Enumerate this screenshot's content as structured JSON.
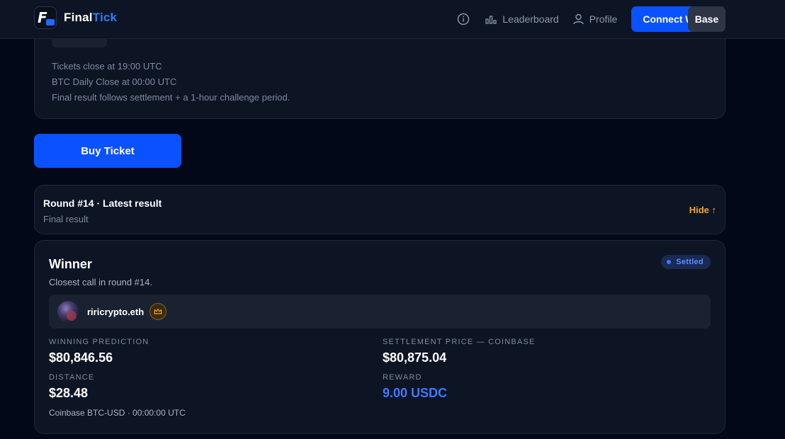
{
  "nav": {
    "brand_part1": "Final",
    "brand_part2": "Tick",
    "leaderboard_label": "Leaderboard",
    "profile_label": "Profile",
    "connect_label": "Connect Wallet",
    "network_label": "Base",
    "icons": [
      "info-icon",
      "leaderboard-icon",
      "profile-icon"
    ]
  },
  "info_card": {
    "lines": [
      "Tickets close at 19:00 UTC",
      "BTC Daily Close at 00:00 UTC",
      "Final result follows settlement + a 1-hour challenge period."
    ]
  },
  "buy_button_label": "Buy Ticket",
  "round": {
    "title": "Round #14 · Latest result",
    "subtitle": "Final result",
    "toggle_label": "Hide ↑"
  },
  "winner": {
    "title": "Winner",
    "subtitle": "Closest call in round #14.",
    "status": "Settled",
    "name": "riricrypto.eth",
    "winning_prediction_label": "Winning prediction",
    "winning_prediction": "$80,846.56",
    "settlement_label": "Settlement price — Coinbase",
    "settlement_price": "$80,875.04",
    "distance_label": "Distance",
    "distance": "$28.48",
    "reward_label": "Reward",
    "reward": "9.00 USDC",
    "source_note": "Coinbase BTC-USD · 00:00:00 UTC"
  },
  "colors": {
    "background": "#030818",
    "card": "#0d1424",
    "primary": "#0a52ff",
    "accent_orange": "#f5a623",
    "reward_blue": "#3b7bff"
  }
}
